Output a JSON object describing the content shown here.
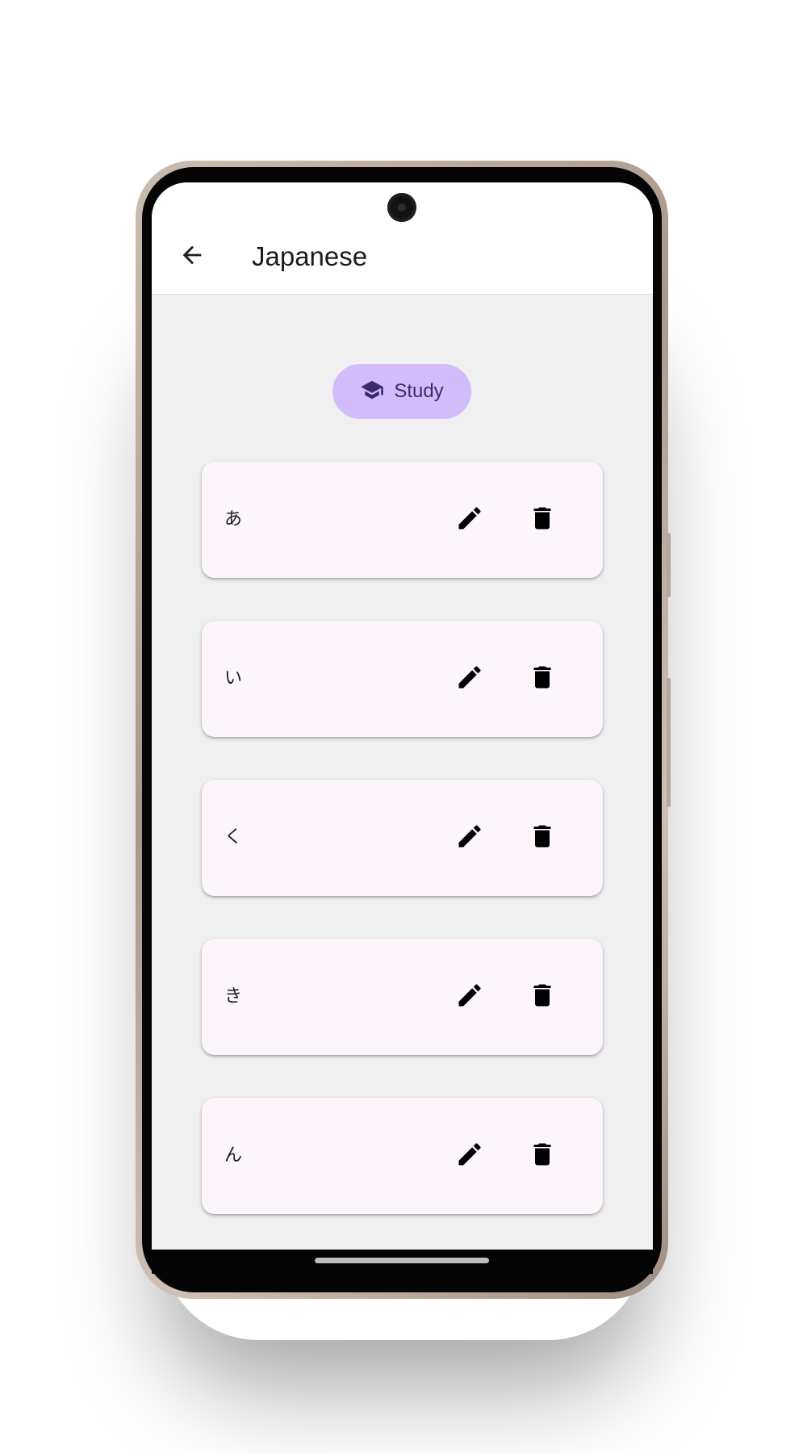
{
  "app_bar": {
    "title": "Japanese",
    "back_icon": "arrow-back-icon"
  },
  "study_button": {
    "label": "Study",
    "icon": "school-cap-icon",
    "color": "#d3bcfa"
  },
  "cards": [
    {
      "text": "あ"
    },
    {
      "text": "い"
    },
    {
      "text": "く"
    },
    {
      "text": "き"
    },
    {
      "text": "ん"
    }
  ],
  "icons": {
    "edit": "edit-pencil-icon",
    "delete": "trash-icon"
  },
  "colors": {
    "background": "#f0f0f0",
    "card": "#fcf6fc",
    "accent": "#d3bcfa"
  }
}
